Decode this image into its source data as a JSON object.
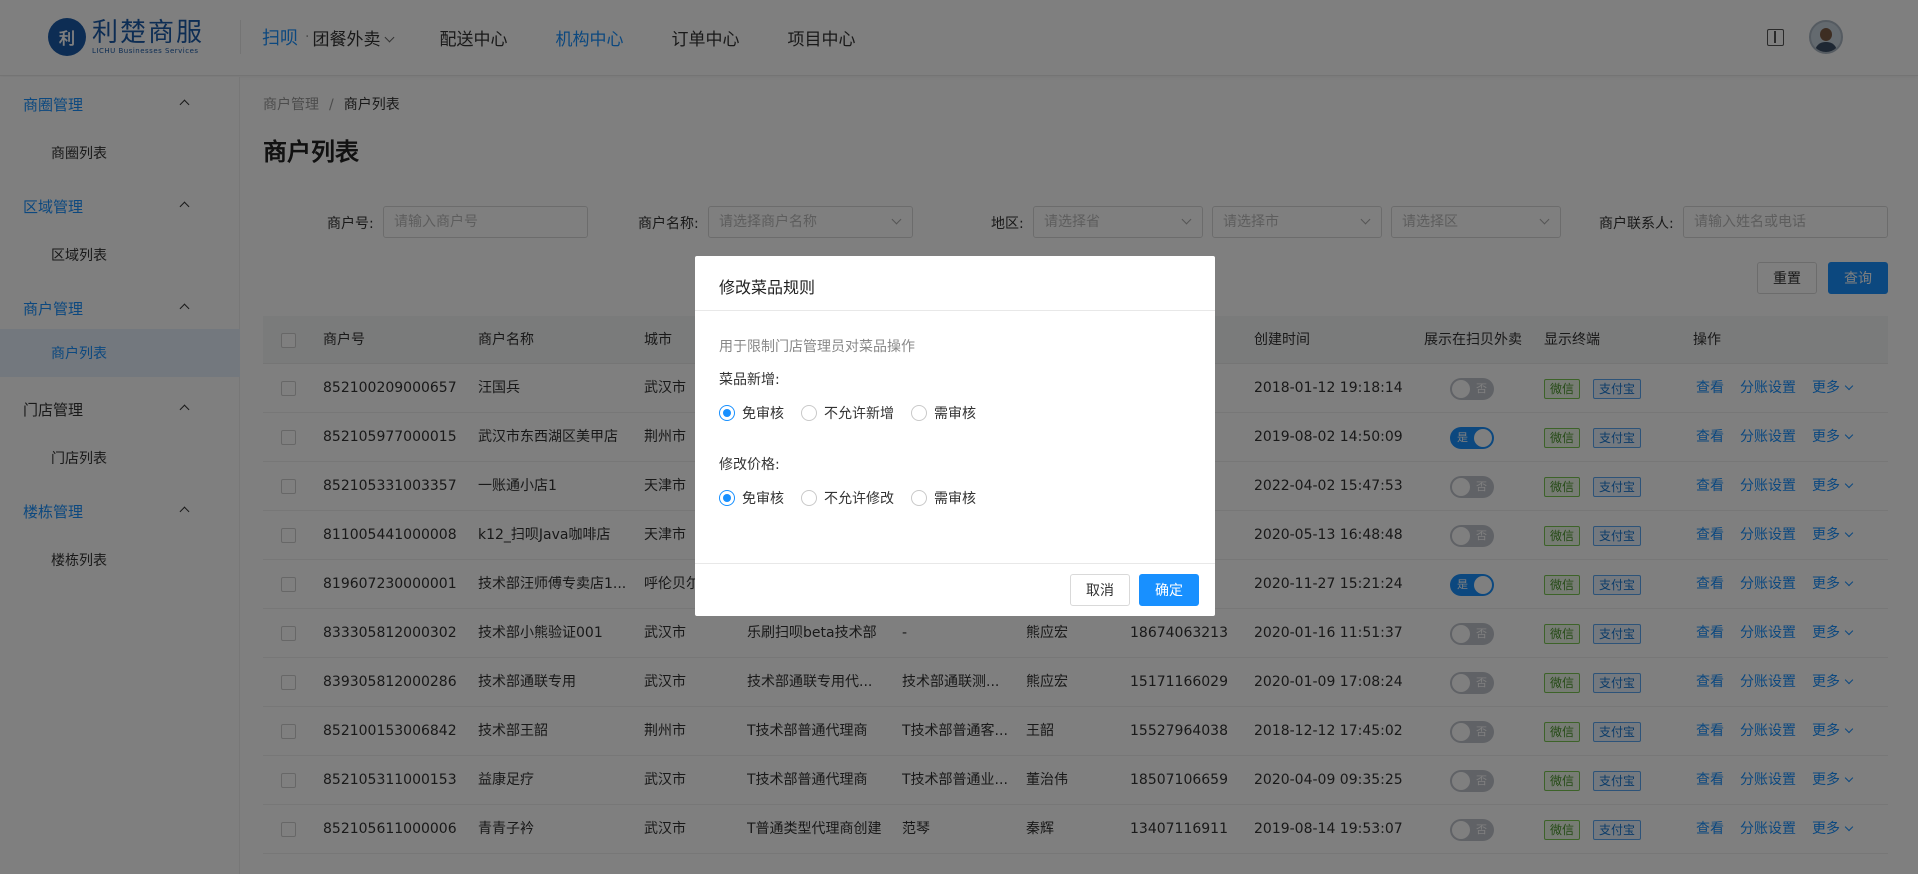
{
  "header": {
    "logo_mark": "利",
    "logo_name": "利楚商服",
    "logo_sub": "LICHU Businesses Services",
    "brand": "扫呗",
    "sep": "·",
    "nav": [
      "团餐外卖",
      "配送中心",
      "机构中心",
      "订单中心",
      "项目中心"
    ]
  },
  "sidebar": {
    "groups": [
      {
        "label": "商圈管理",
        "child": "商圈列表"
      },
      {
        "label": "区域管理",
        "child": "区域列表"
      },
      {
        "label": "商户管理",
        "child": "商户列表"
      },
      {
        "label": "门店管理",
        "child": "门店列表"
      },
      {
        "label": "楼栋管理",
        "child": "楼栋列表"
      }
    ]
  },
  "breadcrumb": {
    "parent": "商户管理",
    "sep": "/",
    "current": "商户列表"
  },
  "page_title": "商户列表",
  "filters": {
    "merchant_no_label": "商户号:",
    "merchant_no_placeholder": "请输入商户号",
    "merchant_name_label": "商户名称:",
    "merchant_name_placeholder": "请选择商户名称",
    "region_label": "地区:",
    "province_placeholder": "请选择省",
    "city_placeholder": "请选择市",
    "district_placeholder": "请选择区",
    "contact_label": "商户联系人:",
    "contact_placeholder": "请输入姓名或电话",
    "reset": "重置",
    "query": "查询"
  },
  "table": {
    "headers": {
      "no": "商户号",
      "name": "商户名称",
      "city": "城市",
      "created": "创建时间",
      "show": "展示在扫贝外卖",
      "terminal": "显示终端",
      "ops": "操作"
    },
    "tag_wx": "微信",
    "tag_ali": "支付宝",
    "op_view": "查看",
    "op_split": "分账设置",
    "op_more": "更多",
    "toggle_on": "是",
    "toggle_off": "否",
    "rows": [
      {
        "no": "852100209000657",
        "name": "汪国兵",
        "city": "武汉市",
        "agent": "",
        "store": "",
        "contact": "",
        "phone": "",
        "created": "2018-01-12 19:18:14",
        "show": false
      },
      {
        "no": "852105977000015",
        "name": "武汉市东西湖区美甲店",
        "city": "荆州市",
        "agent": "",
        "store": "",
        "contact": "",
        "phone": "",
        "created": "2019-08-02 14:50:09",
        "show": true
      },
      {
        "no": "852105331003357",
        "name": "一账通小店1",
        "city": "天津市",
        "agent": "",
        "store": "",
        "contact": "",
        "phone": "",
        "created": "2022-04-02 15:47:53",
        "show": false
      },
      {
        "no": "811005441000008",
        "name": "k12_扫呗Java咖啡店",
        "city": "天津市",
        "agent": "",
        "store": "",
        "contact": "",
        "phone": "",
        "created": "2020-05-13 16:48:48",
        "show": false
      },
      {
        "no": "819607230000001",
        "name": "技术部汪师傅专卖店1...",
        "city": "呼伦贝尔",
        "agent": "",
        "store": "",
        "contact": "",
        "phone": "",
        "created": "2020-11-27 15:21:24",
        "show": true
      },
      {
        "no": "833305812000302",
        "name": "技术部小熊验证001",
        "city": "武汉市",
        "agent": "乐刷扫呗beta技术部",
        "store": "-",
        "contact": "熊应宏",
        "phone": "18674063213",
        "created": "2020-01-16 11:51:37",
        "show": false
      },
      {
        "no": "839305812000286",
        "name": "技术部通联专用",
        "city": "武汉市",
        "agent": "技术部通联专用代...",
        "store": "技术部通联测...",
        "contact": "熊应宏",
        "phone": "15171166029",
        "created": "2020-01-09 17:08:24",
        "show": false
      },
      {
        "no": "852100153006842",
        "name": "技术部王韶",
        "city": "荆州市",
        "agent": "T技术部普通代理商",
        "store": "T技术部普通客...",
        "contact": "王韶",
        "phone": "15527964038",
        "created": "2018-12-12 17:45:02",
        "show": false
      },
      {
        "no": "852105311000153",
        "name": "益康足疗",
        "city": "武汉市",
        "agent": "T技术部普通代理商",
        "store": "T技术部普通业...",
        "contact": "董治伟",
        "phone": "18507106659",
        "created": "2020-04-09 09:35:25",
        "show": false
      },
      {
        "no": "852105611000006",
        "name": "青青子衿",
        "city": "武汉市",
        "agent": "T普通类型代理商创建",
        "store": "范琴",
        "contact": "秦辉",
        "phone": "13407116911",
        "created": "2019-08-14 19:53:07",
        "show": false
      }
    ]
  },
  "modal": {
    "title": "修改菜品规则",
    "desc": "用于限制门店管理员对菜品操作",
    "add_label": "菜品新增:",
    "add_options": [
      "免审核",
      "不允许新增",
      "需审核"
    ],
    "add_selected": "免审核",
    "price_label": "修改价格:",
    "price_options": [
      "免审核",
      "不允许修改",
      "需审核"
    ],
    "price_selected": "免审核",
    "cancel": "取消",
    "confirm": "确定"
  }
}
